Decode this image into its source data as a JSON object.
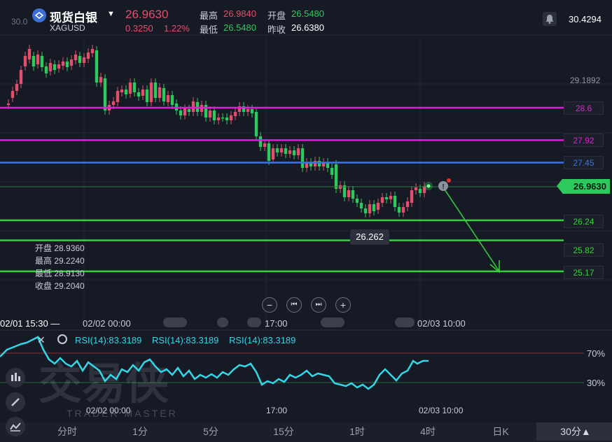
{
  "header": {
    "name": "现货白银",
    "code": "XAGUSD",
    "price": "26.9630",
    "change": "0.3250",
    "change_pct": "1.22%",
    "high_label": "最高",
    "high": "26.9840",
    "low_label": "最低",
    "low": "26.5480",
    "open_label": "开盘",
    "open": "26.5480",
    "prev_close_label": "昨收",
    "prev_close": "26.6380",
    "right_value": "30.4294"
  },
  "axis": {
    "left_top": "30.0",
    "right_mid": "29.1892"
  },
  "price_lines": [
    {
      "label": "28.6",
      "value": 28.6,
      "color": "#e01ed8"
    },
    {
      "label": "27.92",
      "value": 27.92,
      "color": "#e01ed8"
    },
    {
      "label": "27.45",
      "value": 27.45,
      "color": "#3d73e6"
    },
    {
      "label": "26.24",
      "value": 26.24,
      "color": "#35d13a"
    },
    {
      "label": "25.82",
      "value": 25.82,
      "color": "#35d13a"
    },
    {
      "label": "25.17",
      "value": 25.17,
      "color": "#35d13a"
    }
  ],
  "current_price": "26.9630",
  "low_marker": "26.262",
  "hover_ohlc": {
    "open": "开盘 28.9360",
    "high": "最高 29.2240",
    "low": "最低 28.9130",
    "close": "收盘 29.2040"
  },
  "controls": [
    "−",
    "⏮",
    "⏭",
    "+"
  ],
  "time_axis": {
    "crosshair": "02/01 15:30 —",
    "t1": "02/02 00:00",
    "t2": "17:00",
    "t3": "02/03 10:00"
  },
  "rsi": {
    "labels": [
      "RSI(14):83.3189",
      "RSI(14):83.3189",
      "RSI(14):83.3189"
    ],
    "level_high": "70%",
    "level_low": "30%",
    "t1": "02/02 00:00",
    "t2": "17:00",
    "t3": "02/03 10:00"
  },
  "watermark": {
    "main": "交易侠",
    "sub": "TRADER MASTER"
  },
  "tabs": [
    "分时",
    "1分",
    "5分",
    "15分",
    "1时",
    "4时",
    "日K",
    "30分▲"
  ],
  "colors": {
    "up": "#e0506c",
    "down": "#2ec95c",
    "rsi": "#33d6e6",
    "background": "#161a25"
  },
  "chart_data": {
    "type": "candlestick",
    "symbol": "XAGUSD",
    "last_price": 26.963,
    "low_marker": 26.262,
    "horizontal_levels": [
      28.6,
      27.92,
      27.45,
      26.24,
      25.82,
      25.17
    ],
    "rsi_levels": [
      70,
      30
    ],
    "rsi_value": 83.3189
  }
}
